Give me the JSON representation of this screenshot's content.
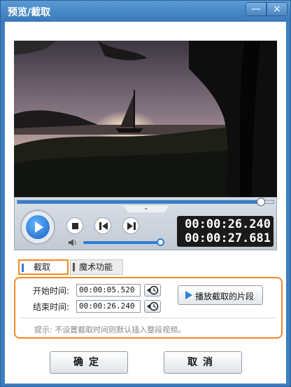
{
  "window": {
    "title": "预览/截取",
    "minimize_label": "—",
    "close_label": "×"
  },
  "player": {
    "current_time": "00:00:26.240",
    "total_time": "00:00:27.681",
    "seek_progress": 0.95,
    "volume_level": 0.98
  },
  "tabs": [
    {
      "label": "截取"
    },
    {
      "label": "魔术功能"
    }
  ],
  "trim": {
    "start_label": "开始时间:",
    "start_value": "00:00:05.520",
    "end_label": "结束时间:",
    "end_value": "00:00:26.240",
    "play_segment_label": "播放截取的片段",
    "hint": "提示: 不设置截取时间则默认插入整段视频。"
  },
  "buttons": {
    "ok": "确定",
    "cancel": "取消"
  },
  "colors": {
    "accent_blue": "#2f7ed8",
    "highlight_orange": "#f08a24",
    "titlebar_blue": "#3d7fc0"
  }
}
